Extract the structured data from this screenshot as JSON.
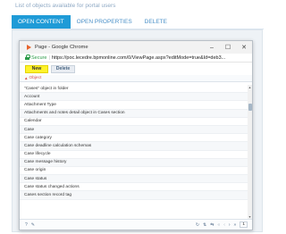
{
  "header": {
    "title": "List of objects available for portal users",
    "tabs": [
      {
        "label": "OPEN CONTENT",
        "active": true
      },
      {
        "label": "OPEN PROPERTIES",
        "active": false
      },
      {
        "label": "DELETE",
        "active": false
      }
    ]
  },
  "window": {
    "title": "Page - Google Chrome",
    "minimize_glyph": "–",
    "maximize_glyph": "☐",
    "close_glyph": "✕",
    "secure_label": "Secure",
    "address_separator": "|",
    "url": "https://poc.lecedre.bpmonline.com/0/ViewPage.aspx?editMode=true&Id=deb3..."
  },
  "toolbar": {
    "new_label": "New",
    "delete_label": "Delete"
  },
  "grid": {
    "column_header": "Object",
    "sort_glyph": "▲",
    "rows": [
      "\"Cases\" object in folder",
      "Account",
      "Attachment Type",
      "Attachments and notes detail object in Cases section",
      "Calendar",
      "Case",
      "Case category",
      "Case deadline calculation schemas",
      "Case lifecycle",
      "Case message history",
      "Case origin",
      "Case status",
      "Case status changed actions",
      "Cases section record tag"
    ]
  },
  "footer": {
    "left_icons": [
      "?",
      "✎"
    ],
    "right_controls": [
      "↻",
      "⇅",
      "⇆",
      "«",
      "‹",
      "›",
      "»"
    ],
    "page_number": "1"
  },
  "colors": {
    "accent": "#1f9bd7",
    "new_button": "#fff22b",
    "header_text": "#d9534f",
    "secure": "#2c9b48"
  }
}
